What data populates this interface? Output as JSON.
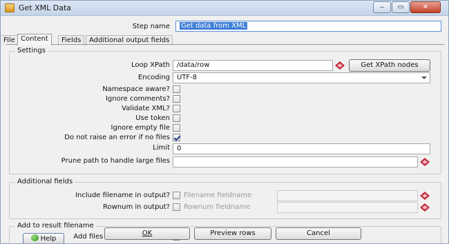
{
  "window": {
    "title": "Get XML Data",
    "minimize": "‒",
    "maximize": "▭",
    "close": "✕"
  },
  "step": {
    "label": "Step name",
    "value": "Get data from XML"
  },
  "tabs": [
    {
      "label": "File"
    },
    {
      "label": "Content"
    },
    {
      "label": "Fields"
    },
    {
      "label": "Additional output fields"
    }
  ],
  "settings": {
    "title": "Settings",
    "loop_xpath_label": "Loop XPath",
    "loop_xpath_value": "/data/row",
    "get_xpath_button": "Get XPath nodes",
    "encoding_label": "Encoding",
    "encoding_value": "UTF-8",
    "namespace_label": "Namespace aware?",
    "ignore_comments_label": "Ignore comments?",
    "validate_xml_label": "Validate XML?",
    "use_token_label": "Use token",
    "ignore_empty_label": "Ignore empty file",
    "no_error_label": "Do not raise an error if no files",
    "limit_label": "Limit",
    "limit_value": "0",
    "prune_label": "Prune path to handle large files",
    "prune_value": ""
  },
  "additional": {
    "title": "Additional fields",
    "include_filename_label": "Include filename in output?",
    "filename_fieldname_label": "Filename fieldname",
    "rownum_label": "Rownum in output?",
    "rownum_fieldname_label": "Rownum fieldname"
  },
  "result": {
    "title": "Add to result filename",
    "add_files_label": "Add files to result filesname"
  },
  "buttons": {
    "ok": "OK",
    "preview": "Preview rows",
    "cancel": "Cancel",
    "help": "Help"
  },
  "checked": {
    "namespace": false,
    "ignore_comments": false,
    "validate_xml": false,
    "use_token": false,
    "ignore_empty": false,
    "no_error": true,
    "include_filename": false,
    "rownum": false,
    "add_files": false
  }
}
